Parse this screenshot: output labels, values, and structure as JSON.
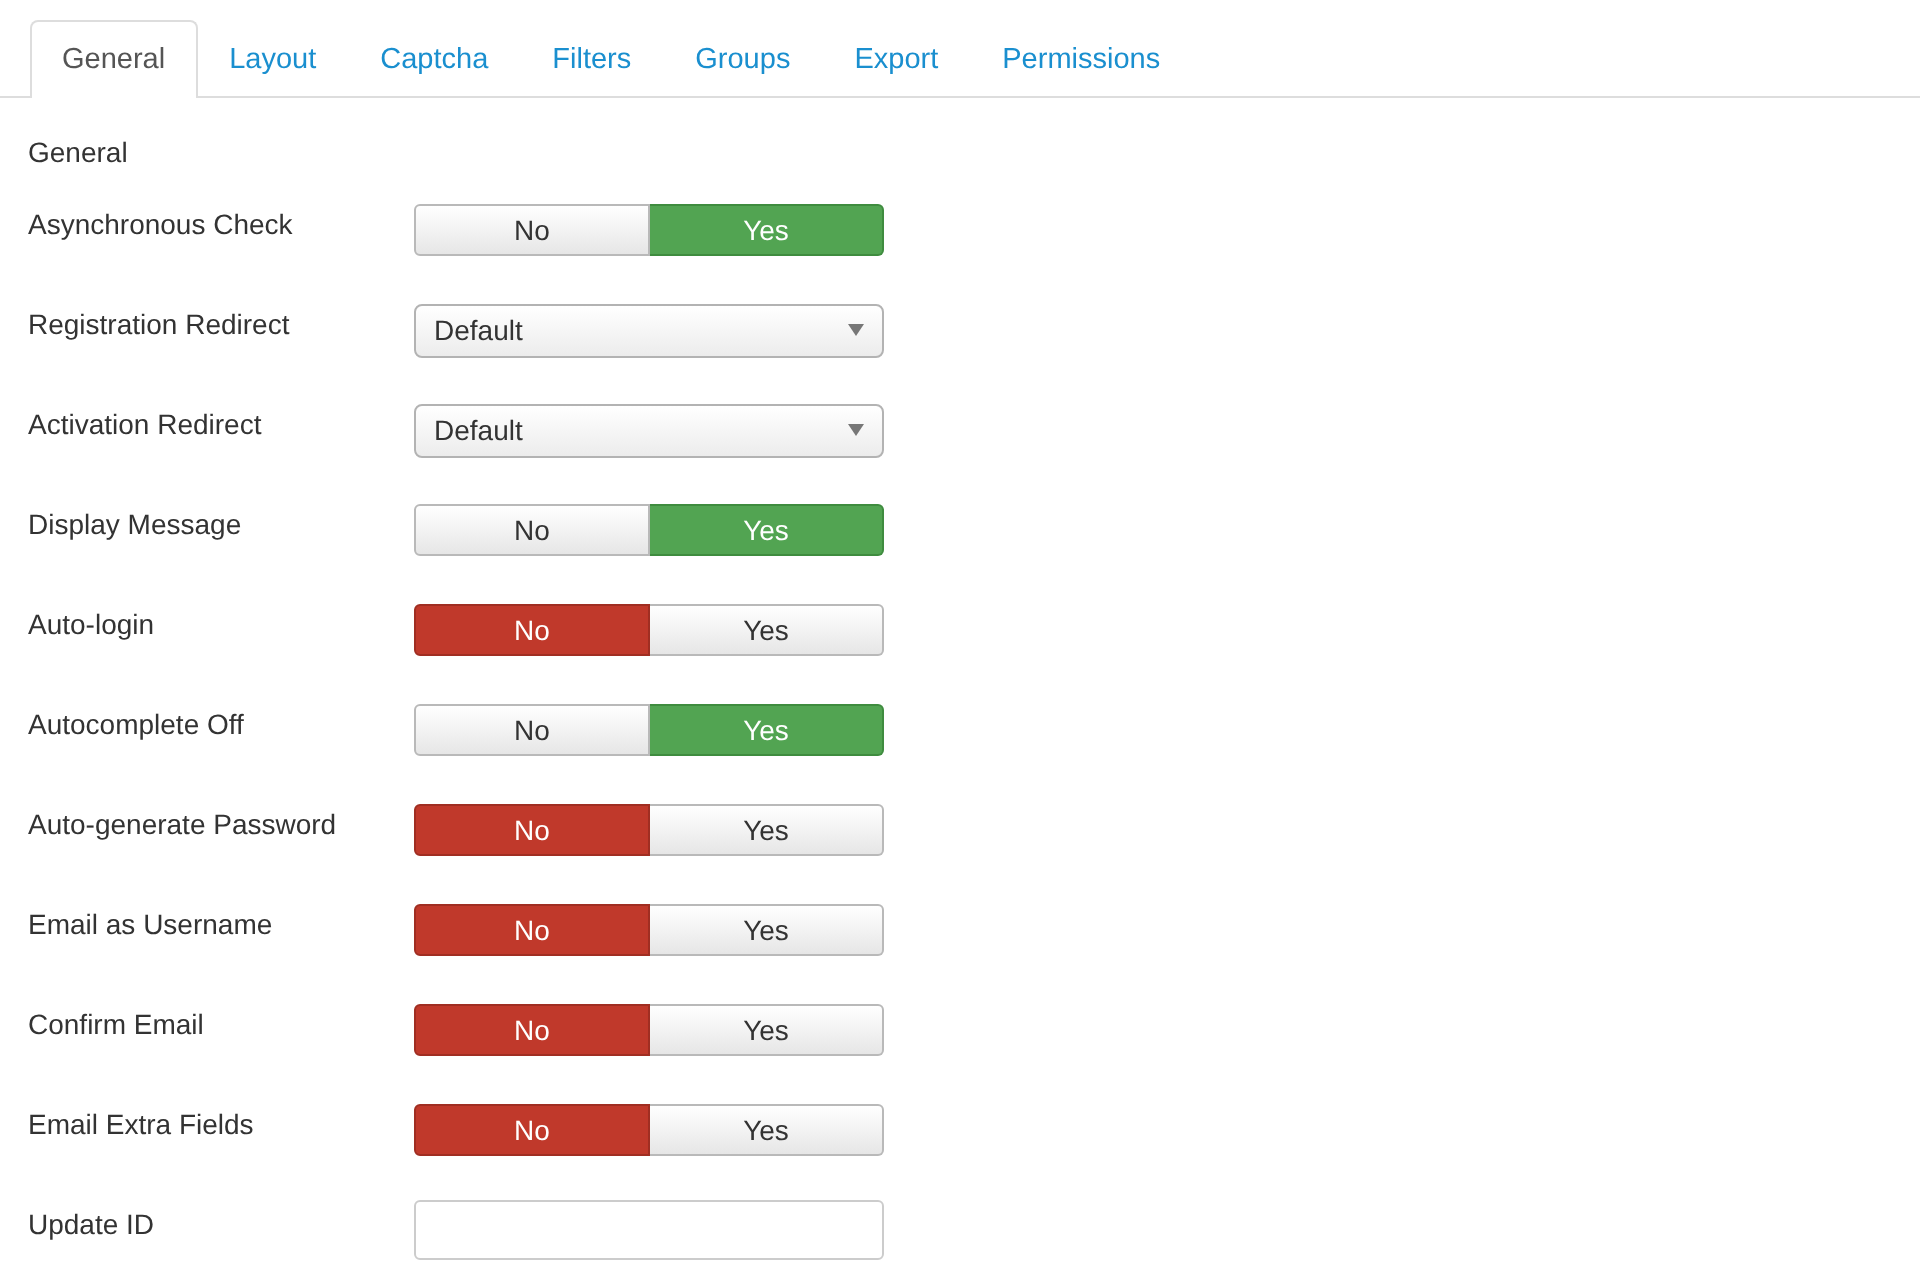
{
  "tabs": [
    {
      "label": "General",
      "selected": true
    },
    {
      "label": "Layout",
      "selected": false
    },
    {
      "label": "Captcha",
      "selected": false
    },
    {
      "label": "Filters",
      "selected": false
    },
    {
      "label": "Groups",
      "selected": false
    },
    {
      "label": "Export",
      "selected": false
    },
    {
      "label": "Permissions",
      "selected": false
    }
  ],
  "section": {
    "title": "General"
  },
  "fields": [
    {
      "label": "Asynchronous Check",
      "kind": "toggle",
      "options": [
        {
          "label": "No",
          "selected": false
        },
        {
          "label": "Yes",
          "selected": true
        }
      ]
    },
    {
      "label": "Registration Redirect",
      "kind": "select",
      "value": "Default"
    },
    {
      "label": "Activation Redirect",
      "kind": "select",
      "value": "Default"
    },
    {
      "label": "Display Message",
      "kind": "toggle",
      "options": [
        {
          "label": "No",
          "selected": false
        },
        {
          "label": "Yes",
          "selected": true
        }
      ]
    },
    {
      "label": "Auto-login",
      "kind": "toggle",
      "options": [
        {
          "label": "No",
          "selected": true
        },
        {
          "label": "Yes",
          "selected": false
        }
      ]
    },
    {
      "label": "Autocomplete Off",
      "kind": "toggle",
      "options": [
        {
          "label": "No",
          "selected": false
        },
        {
          "label": "Yes",
          "selected": true
        }
      ]
    },
    {
      "label": "Auto-generate Password",
      "kind": "toggle",
      "options": [
        {
          "label": "No",
          "selected": true
        },
        {
          "label": "Yes",
          "selected": false
        }
      ]
    },
    {
      "label": "Email as Username",
      "kind": "toggle",
      "options": [
        {
          "label": "No",
          "selected": true
        },
        {
          "label": "Yes",
          "selected": false
        }
      ]
    },
    {
      "label": "Confirm Email",
      "kind": "toggle",
      "options": [
        {
          "label": "No",
          "selected": true
        },
        {
          "label": "Yes",
          "selected": false
        }
      ]
    },
    {
      "label": "Email Extra Fields",
      "kind": "toggle",
      "options": [
        {
          "label": "No",
          "selected": true
        },
        {
          "label": "Yes",
          "selected": false
        }
      ]
    },
    {
      "label": "Update ID",
      "kind": "text"
    }
  ]
}
